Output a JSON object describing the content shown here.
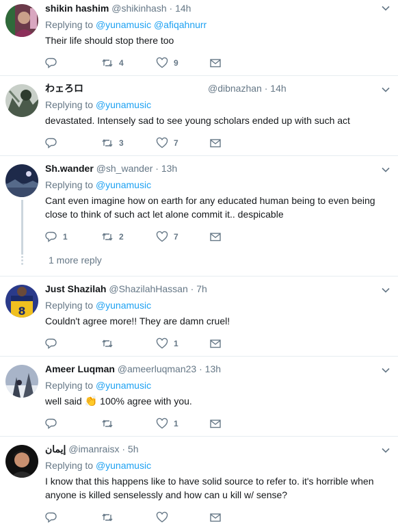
{
  "tweets": [
    {
      "fullname": "shikin hashim",
      "username": "@shikinhash",
      "separator": "·",
      "time": "14h",
      "replying_prefix": "Replying to",
      "replying_to": "@yunamusic @afiqahnurr",
      "text": "Their life should stop there too",
      "replies": "",
      "retweets": "4",
      "likes": "9"
    },
    {
      "fullname": "わェろロ",
      "username": "@dibnazhan",
      "separator": "·",
      "time": "14h",
      "replying_prefix": "Replying to",
      "replying_to": "@yunamusic",
      "text": "devastated. Intensely sad to see young scholars ended up with such act",
      "replies": "",
      "retweets": "3",
      "likes": "7"
    },
    {
      "fullname": "Sh.wander",
      "username": "@sh_wander",
      "separator": "·",
      "time": "13h",
      "replying_prefix": "Replying to",
      "replying_to": "@yunamusic",
      "text": "Cant even imagine how on earth for  any educated human being to even being close to think of such act let alone commit it.. despicable",
      "replies": "1",
      "retweets": "2",
      "likes": "7",
      "more_replies": "1 more reply"
    },
    {
      "fullname": "Just Shazilah",
      "username": "@ShazilahHassan",
      "separator": "·",
      "time": "7h",
      "replying_prefix": "Replying to",
      "replying_to": "@yunamusic",
      "text": "Couldn't agree more!! They are damn cruel!",
      "replies": "",
      "retweets": "",
      "likes": "1"
    },
    {
      "fullname": "Ameer Luqman",
      "username": "@ameerluqman23",
      "separator": "·",
      "time": "13h",
      "replying_prefix": "Replying to",
      "replying_to": "@yunamusic",
      "text_before": "well said",
      "emoji": "👏",
      "text_after": "100% agree with you.",
      "replies": "",
      "retweets": "",
      "likes": "1"
    },
    {
      "fullname": "إيمان",
      "username": "@imanraisx",
      "separator": "·",
      "time": "5h",
      "replying_prefix": "Replying to",
      "replying_to": "@yunamusic",
      "text": "I know that this happens like to have solid source to refer to. it's horrible when anyone is killed senselessly and how can u kill w/ sense?",
      "replies": "",
      "retweets": "",
      "likes": ""
    }
  ],
  "icons": {
    "reply": "reply-icon",
    "retweet": "retweet-icon",
    "like": "heart-icon",
    "dm": "envelope-icon",
    "caret": "chevron-down-icon"
  },
  "colors": {
    "link": "#1da1f2",
    "secondary": "#657786",
    "primary_text": "#14171a",
    "divider": "#e6ecf0"
  }
}
